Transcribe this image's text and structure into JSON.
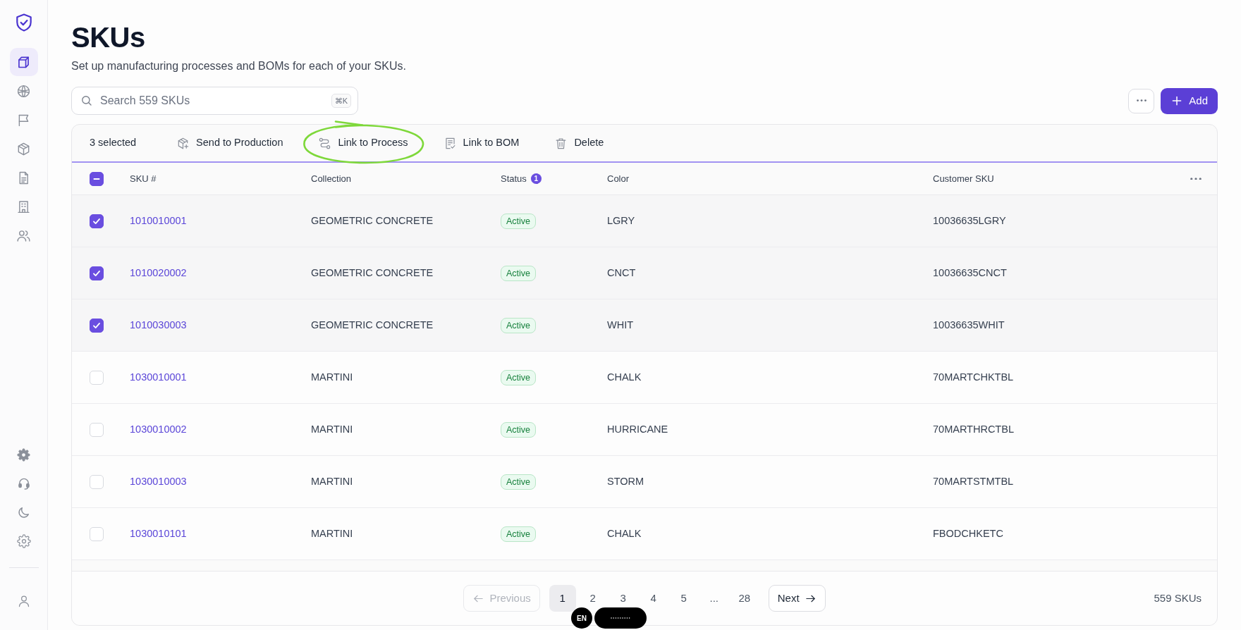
{
  "sidebar": {
    "items": [
      {
        "selected": true
      },
      {
        "selected": false
      },
      {
        "selected": false
      },
      {
        "selected": false
      },
      {
        "selected": false
      },
      {
        "selected": false
      },
      {
        "selected": false
      }
    ]
  },
  "page": {
    "title": "SKUs",
    "subtitle": "Set up manufacturing processes and BOMs for each of your SKUs."
  },
  "search": {
    "placeholder": "Search 559 SKUs",
    "shortcut": "⌘K"
  },
  "add_button": {
    "label": "Add"
  },
  "bulk_actions": {
    "selected_count": "3 selected",
    "actions": [
      {
        "label": "Send to Production",
        "highlighted": false
      },
      {
        "label": "Link to Process",
        "highlighted": true
      },
      {
        "label": "Link to BOM",
        "highlighted": false
      },
      {
        "label": "Delete",
        "highlighted": false
      }
    ]
  },
  "table": {
    "select_all": {
      "indeterminate": true
    },
    "columns": [
      {
        "label": "SKU #"
      },
      {
        "label": "Collection"
      },
      {
        "label": "Status",
        "badge": "1"
      },
      {
        "label": "Color"
      },
      {
        "label": "Customer SKU"
      }
    ],
    "rows": [
      {
        "selected": true,
        "sku": "1010010001",
        "collection": "GEOMETRIC CONCRETE",
        "status": "Active",
        "color_name": "LGRY",
        "customer_sku": "10036635LGRY"
      },
      {
        "selected": true,
        "sku": "1010020002",
        "collection": "GEOMETRIC CONCRETE",
        "status": "Active",
        "color_name": "CNCT",
        "customer_sku": "10036635CNCT"
      },
      {
        "selected": true,
        "sku": "1010030003",
        "collection": "GEOMETRIC CONCRETE",
        "status": "Active",
        "color_name": "WHIT",
        "customer_sku": "10036635WHIT"
      },
      {
        "selected": false,
        "sku": "1030010001",
        "collection": "MARTINI",
        "status": "Active",
        "color_name": "CHALK",
        "customer_sku": "70MARTCHKTBL"
      },
      {
        "selected": false,
        "sku": "1030010002",
        "collection": "MARTINI",
        "status": "Active",
        "color_name": "HURRICANE",
        "customer_sku": "70MARTHRCTBL"
      },
      {
        "selected": false,
        "sku": "1030010003",
        "collection": "MARTINI",
        "status": "Active",
        "color_name": "STORM",
        "customer_sku": "70MARTSTMTBL"
      },
      {
        "selected": false,
        "sku": "1030010101",
        "collection": "MARTINI",
        "status": "Active",
        "color_name": "CHALK",
        "customer_sku": "FBODCHKETC"
      }
    ]
  },
  "pagination": {
    "previous": {
      "label": "Previous",
      "disabled": true
    },
    "pages": [
      {
        "label": "1",
        "selected": true,
        "kind": "page"
      },
      {
        "label": "2",
        "selected": false,
        "kind": "page"
      },
      {
        "label": "3",
        "selected": false,
        "kind": "page"
      },
      {
        "label": "4",
        "selected": false,
        "kind": "page"
      },
      {
        "label": "5",
        "selected": false,
        "kind": "page"
      },
      {
        "label": "...",
        "kind": "gap"
      },
      {
        "label": "28",
        "selected": false,
        "kind": "page"
      }
    ],
    "next": {
      "label": "Next",
      "disabled": false
    },
    "total": "559 SKUs"
  },
  "language_badge": {
    "label": "EN"
  }
}
